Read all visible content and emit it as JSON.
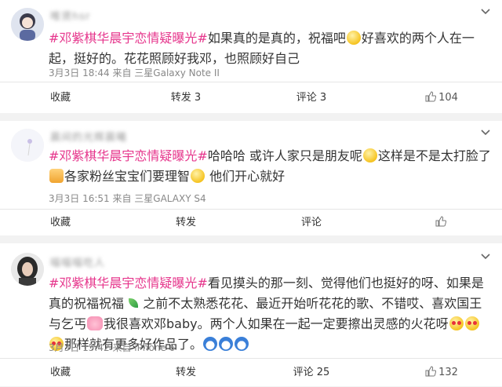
{
  "posts": [
    {
      "username": "唯贤hsr",
      "hashtag": "#邓紫棋华晨宇恋情疑曝光#",
      "text_a": "如果真的是真的，祝福吧",
      "text_b": "好喜欢的两个人在一起，挺好的。花花照顾好我邓，也照顾好自己",
      "meta": "3月3日 18:44 来自 三星Galaxy Note II",
      "actions": {
        "favorite": "收藏",
        "repost": "转发 3",
        "comment": "评论 3",
        "like": "104"
      }
    },
    {
      "username": "晨间的光辉晨曦",
      "hashtag": "#邓紫棋华晨宇恋情疑曝光#",
      "text_a": "哈哈哈 或许人家只是朋友呢",
      "text_b": "这样是不是太打脸了",
      "text_c": "各家粉丝宝宝们要理智",
      "text_d": " 他们开心就好",
      "meta": "3月3日 16:51 来自 三星GALAXY S4",
      "actions": {
        "favorite": "收藏",
        "repost": "转发",
        "comment": "评论",
        "like": ""
      }
    },
    {
      "username": "喵喵喵吃人",
      "hashtag": "#邓紫棋华晨宇恋情疑曝光#",
      "text_a": "看见摸头的那一刻、觉得他们也挺好的呀、如果是真的祝福祝福",
      "text_b": "之前不太熟悉花花、最近开始听花花的歌、不错哎、喜欢国王与乞丐",
      "text_c": "我很喜欢邓baby。两个人如果在一起一定要擦出灵感的火花呀",
      "text_d": "那样就有更多好作品了。",
      "meta": "3月3日 15:42 来自 iPhone 6",
      "actions": {
        "favorite": "收藏",
        "repost": "转发",
        "comment": "评论 25",
        "like": "132"
      }
    }
  ],
  "icons": {
    "chevron": "chevron-down-icon",
    "like": "thumbs-up-icon",
    "emoji_blush": "blush-face-emoji",
    "emoji_heart_eyes": "heart-eyes-emoji",
    "emoji_cat": "cat-emoji",
    "emoji_pig": "pig-emoji",
    "emoji_doraemon": "doraemon-emoji",
    "emoji_leaf": "leaf-emoji"
  },
  "colors": {
    "hashtag": "#e6368c",
    "background": "#f2f2f2",
    "card": "#ffffff"
  }
}
